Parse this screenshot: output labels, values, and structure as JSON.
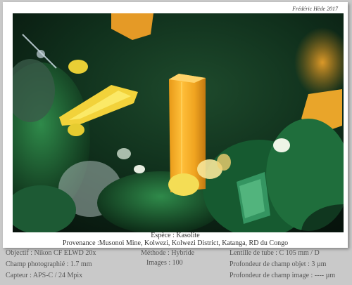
{
  "credit": "Frédéric Hède 2017",
  "caption": {
    "species": "Espèce : Kasolite",
    "provenance": "Provenance :Musonoi Mine, Kolwezi, Kolwezi District, Katanga, RD du Congo"
  },
  "specs": {
    "objectif": "Objectif : Nikon CF ELWD 20x",
    "champ": "Champ photographié : 1.7 mm",
    "capteur": "Capteur : APS-C / 24 Mpix",
    "methode": "Méthode : Hybride",
    "images": "Images : 100",
    "lentille": "Lentille de tube : C 105 mm / D",
    "profondeur_objet": "Profondeur de champ objet : 3 µm",
    "profondeur_image": "Profondeur de champ image : ---- µm"
  }
}
